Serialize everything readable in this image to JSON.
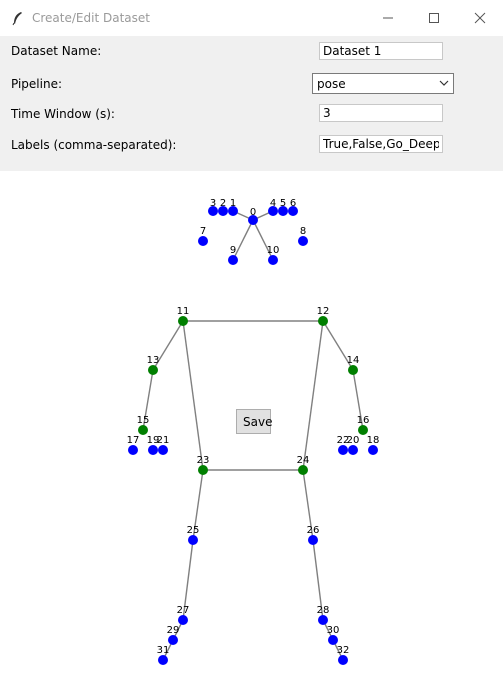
{
  "window": {
    "title": "Create/Edit Dataset"
  },
  "form": {
    "dataset_name_label": "Dataset Name:",
    "dataset_name_value": "Dataset 1",
    "pipeline_label": "Pipeline:",
    "pipeline_value": "pose",
    "time_window_label": "Time Window (s):",
    "time_window_value": "3",
    "labels_label": "Labels (comma-separated):",
    "labels_value": "True,False,Go_Deeper"
  },
  "save_button": {
    "label": "Save"
  },
  "colors": {
    "face_hand_foot_point": "#0000ff",
    "body_joint_point": "#007f00",
    "skeleton_line": "#808080",
    "form_background": "#f0f0f0"
  },
  "icons": {
    "app": "feather-icon",
    "minimize": "minimize-icon",
    "maximize": "maximize-icon",
    "close": "close-icon",
    "dropdown": "chevron-down-icon"
  }
}
